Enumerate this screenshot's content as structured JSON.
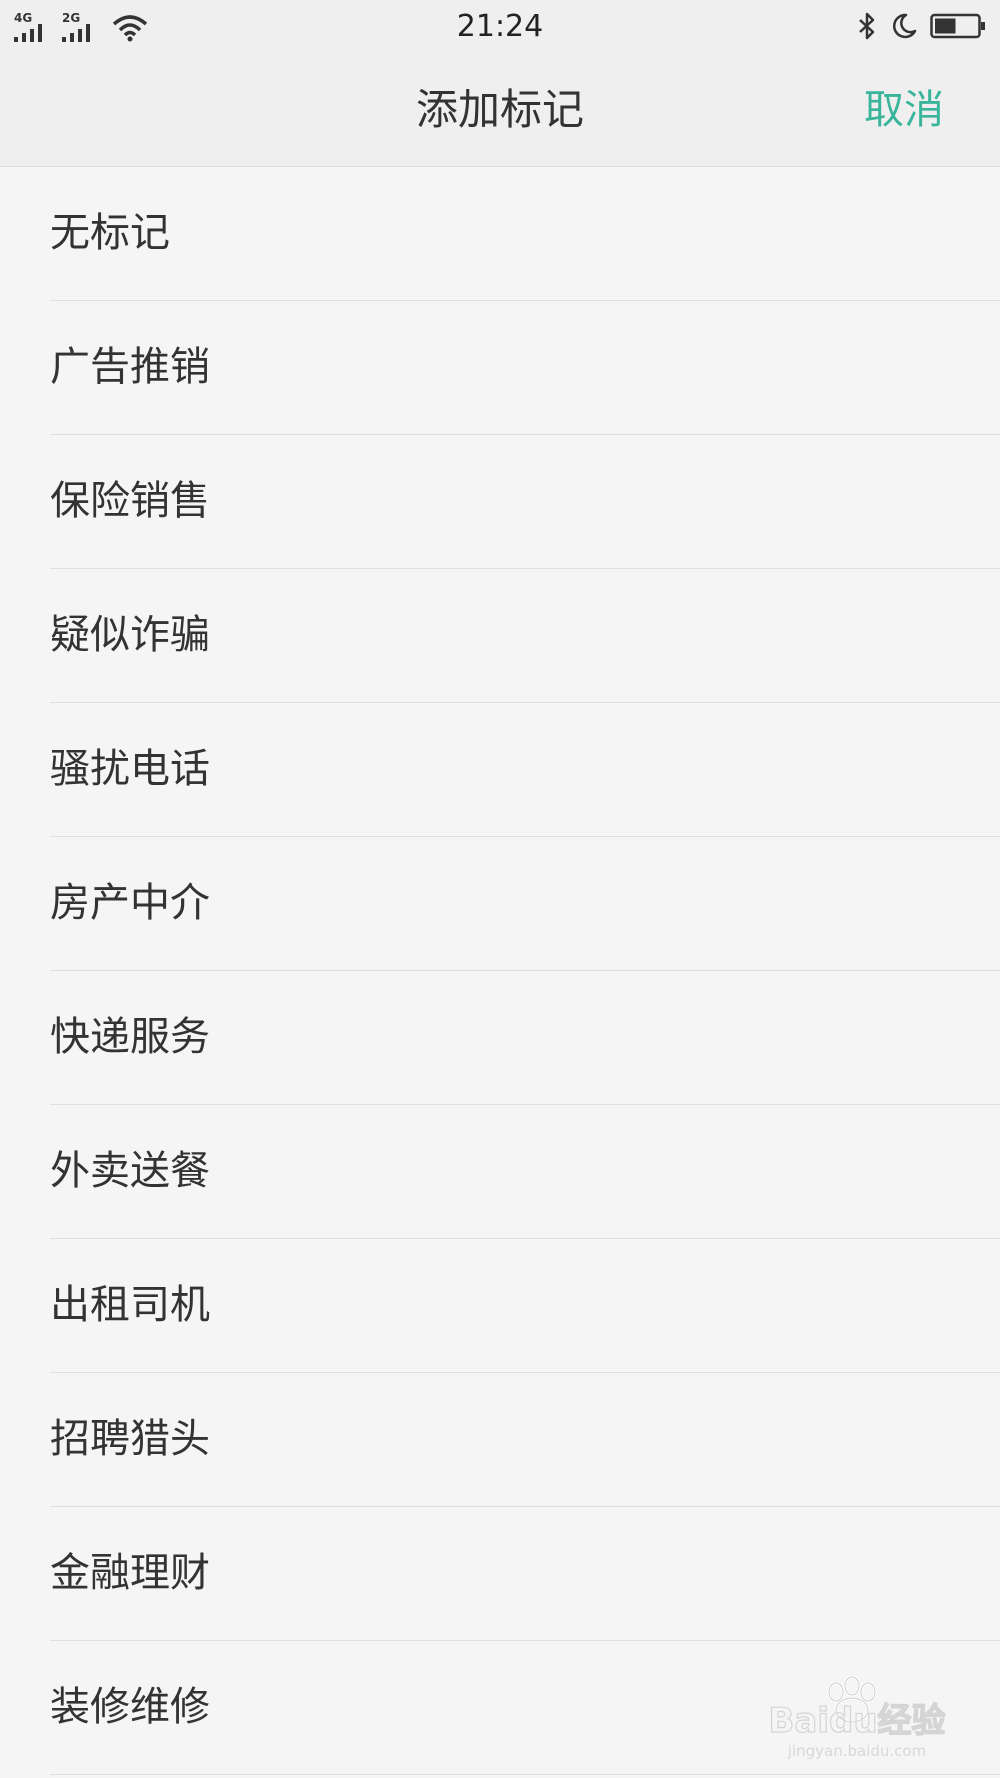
{
  "status_bar": {
    "network_1": "4G",
    "network_2": "2G",
    "time": "21:24",
    "icons": [
      "signal-icon",
      "wifi-icon",
      "bluetooth-icon",
      "moon-icon",
      "battery-icon"
    ],
    "battery_level": 0.5
  },
  "header": {
    "title": "添加标记",
    "cancel_label": "取消"
  },
  "tags": [
    {
      "label": "无标记"
    },
    {
      "label": "广告推销"
    },
    {
      "label": "保险销售"
    },
    {
      "label": "疑似诈骗"
    },
    {
      "label": "骚扰电话"
    },
    {
      "label": "房产中介"
    },
    {
      "label": "快递服务"
    },
    {
      "label": "外卖送餐"
    },
    {
      "label": "出租司机"
    },
    {
      "label": "招聘猎头"
    },
    {
      "label": "金融理财"
    },
    {
      "label": "装修维修"
    }
  ],
  "watermark": {
    "brand": "Baidu经验",
    "url": "jingyan.baidu.com"
  },
  "colors": {
    "accent": "#3ab59b",
    "background": "#f5f5f5",
    "header_bg": "#efefef",
    "text": "#333333",
    "divider": "#e0e0e0"
  }
}
